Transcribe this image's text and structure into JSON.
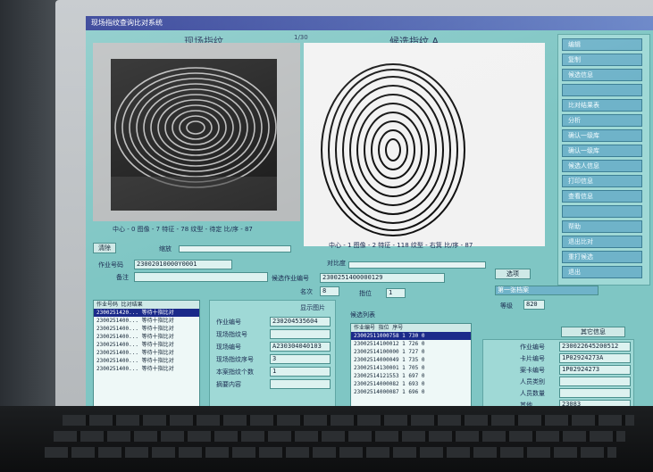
{
  "window": {
    "title": "现场指纹查询比对系统"
  },
  "panels": {
    "latent": {
      "title": "现场指纹",
      "tag": "1/30",
      "caption": "中心 - 0 图像 - 7 特征 - 78 纹型 - 待定 比/序 - 87"
    },
    "candidate": {
      "title": "候选指纹 A",
      "caption": "中心 - 1 图像 - 2 特征 - 118 纹型 - 右箕 比/序 - 87"
    }
  },
  "sidebar": {
    "items": [
      "编辑",
      "复制",
      "候选信息",
      "",
      "比对结果表",
      "分析",
      "确认一级库",
      "确认一级库",
      "候选人信息",
      "打印信息",
      "查看信息",
      "",
      "帮助",
      "退出比对",
      "重打候选",
      "退出"
    ]
  },
  "controls": {
    "clear_label": "清除",
    "zoom_label": "缩放",
    "contrast_label": "对比度",
    "apply_label": "选项",
    "job_no_label": "作业号码",
    "job_no_value": "23002010000Y0001",
    "note_label": "备注",
    "candidate_no_label": "候选作业编号",
    "candidate_no_value": "2300251400000129",
    "score_label": "名次",
    "score_value": "8",
    "finger_label": "指位",
    "finger_value": "1",
    "grade_label": "等级",
    "grade_value": "820",
    "status_value": "第一张档案"
  },
  "lists": {
    "left_header": "作业号码 比对结果",
    "left_rows": [
      "2300251420... 等待十指比对",
      "2300251400... 等待十指比对",
      "2300251400... 等待十指比对",
      "2300251400... 等待十指比对",
      "2300251400... 等待十指比对",
      "2300251400... 等待十指比对",
      "2300251400... 等待十指比对",
      "2300251400... 等待十指比对"
    ],
    "check_label": "显示图片",
    "mid_labels": [
      "作业编号",
      "现场指纹号",
      "现场编号",
      "现场指纹序号",
      "本案指纹个数",
      "摘要内容"
    ],
    "mid_values": [
      "230204535604",
      "",
      "A230304040103",
      "3",
      "1",
      ""
    ],
    "cand_title": "候选列表",
    "cand_header": "作业编号 指位 序号",
    "cand_rows": [
      "23002511000758  1  730  0",
      "23002514100012  1  726  0",
      "23002514100000  1  727  0",
      "23002514000049  1  735  0",
      "23002514130001  1  705  0",
      "23002514121553  1  697  0",
      "23002514000082  1  693  0",
      "23002514000087  1  696  0"
    ],
    "right_title": "其它信息",
    "right_labels": [
      "作业编号",
      "卡片编号",
      "案卡编号",
      "人员类别",
      "人员数量",
      "其他"
    ],
    "right_values": [
      "230022645200512",
      "1P02924273A",
      "1P02924273",
      "",
      "",
      "23083"
    ]
  }
}
